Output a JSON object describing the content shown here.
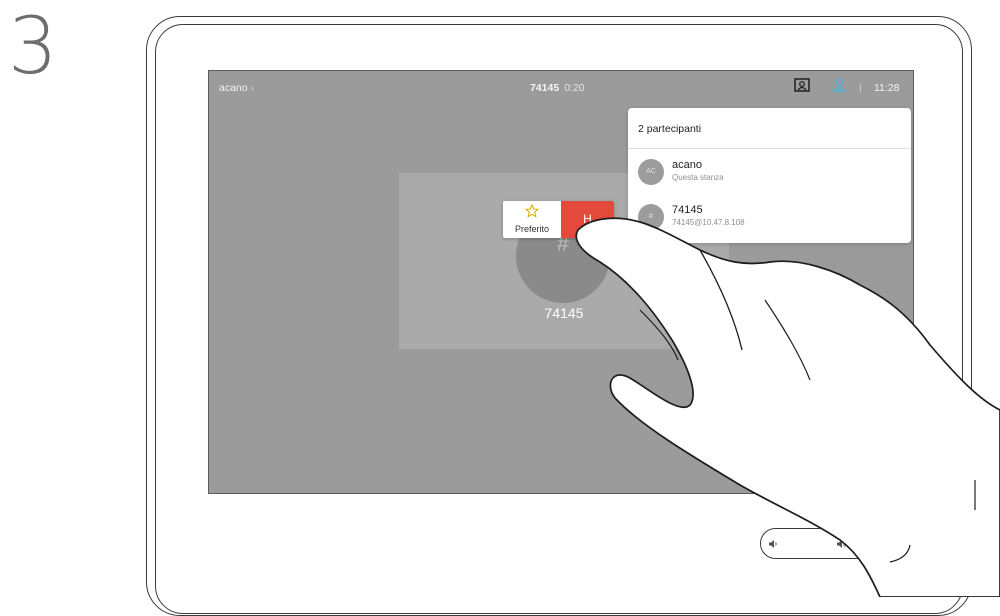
{
  "step": {
    "number": "3"
  },
  "topbar": {
    "call_name": "acano",
    "chevron": "›",
    "call_number": "74145",
    "duration": "0:20",
    "time": "11:28",
    "layout_icon": "layout-icon",
    "participants_icon": "participants-icon"
  },
  "tile": {
    "avatar_glyph": "#",
    "name": "74145"
  },
  "popup": {
    "favorite_label": "Preferito",
    "end_label": "H"
  },
  "participants_panel": {
    "title": "2 partecipanti",
    "items": [
      {
        "initials": "AC",
        "name": "acano",
        "subtitle": "Questa stanza"
      },
      {
        "initials": "#",
        "name": "74145",
        "subtitle": "74145@10.47.8.108"
      }
    ]
  },
  "controls": {
    "volume_down_icon": "volume-down-icon",
    "volume_up_icon": "volume-up-icon"
  },
  "colors": {
    "screen_bg": "#9b9b9b",
    "end_call_red": "#e34a3c",
    "favorite_star": "#e0b100",
    "participants_icon_blue": "#4fb3d9"
  }
}
